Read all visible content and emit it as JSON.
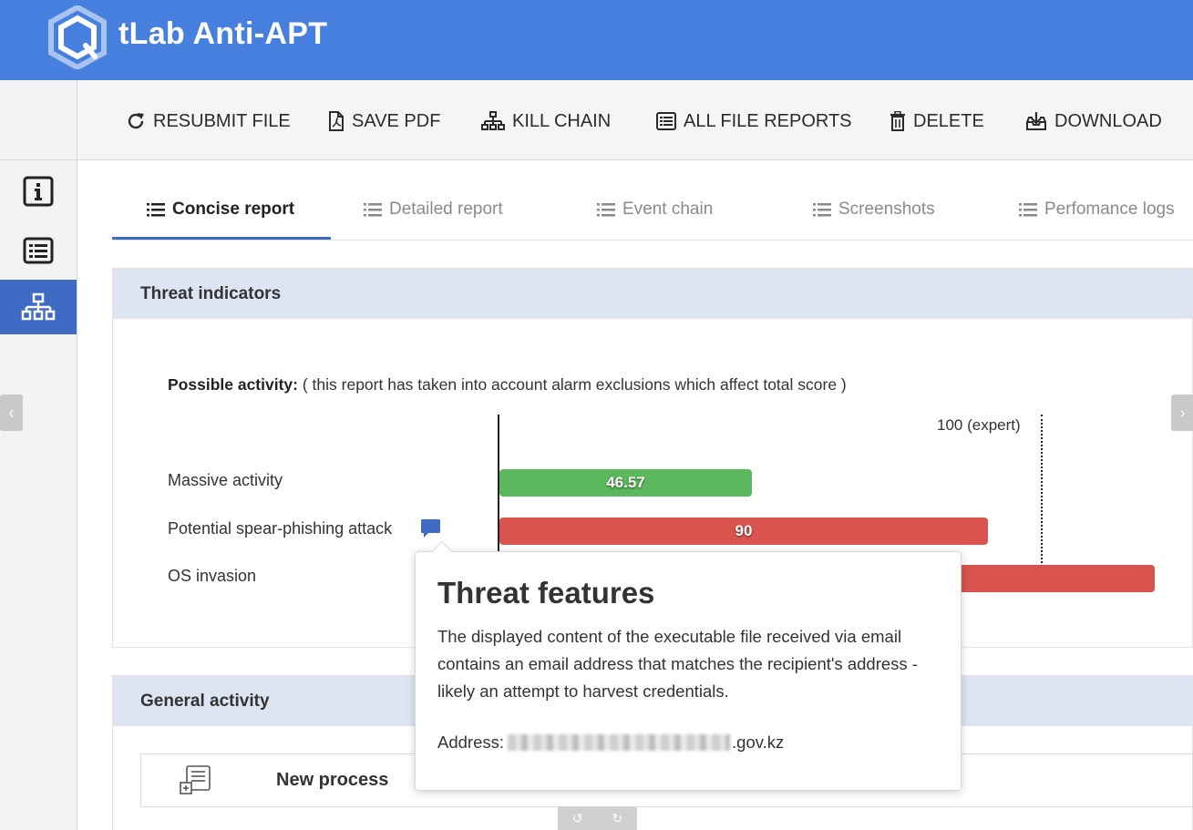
{
  "app": {
    "title": "tLab Anti-APT"
  },
  "toolbar": {
    "resubmit": "RESUBMIT FILE",
    "save_pdf": "SAVE PDF",
    "kill_chain": "KILL CHAIN",
    "all_reports": "ALL FILE REPORTS",
    "delete": "DELETE",
    "download": "DOWNLOAD"
  },
  "sidebar": {
    "items": [
      {
        "name": "info-icon",
        "active": false
      },
      {
        "name": "list-icon",
        "active": false
      },
      {
        "name": "sitemap-icon",
        "active": true
      }
    ]
  },
  "tabs": {
    "concise": "Concise report",
    "detailed": "Detailed report",
    "event_chain": "Event chain",
    "screenshots": "Screenshots",
    "perf_logs": "Perfomance logs",
    "active": "Concise report"
  },
  "threat_indicators": {
    "title": "Threat indicators",
    "possible_label": "Possible activity:",
    "possible_note": " ( this report has taken into account alarm exclusions which affect total score )",
    "expert_label": "100 (expert)",
    "items": [
      {
        "label": "Massive activity",
        "score": 46.57,
        "score_text": "46.57",
        "color": "#5cb85c"
      },
      {
        "label": "Potential spear-phishing attack",
        "score": 90,
        "score_text": "90",
        "color": "#d9534f",
        "has_comment": true
      },
      {
        "label": "OS invasion",
        "score_text": "",
        "color": "#d9534f"
      }
    ]
  },
  "general_activity": {
    "title": "General activity",
    "process_label": "New process"
  },
  "tooltip": {
    "title": "Threat features",
    "description": "The displayed content of the executable file received via email contains an email address that matches the recipient's address - likely an attempt to harvest credentials.",
    "address_label": "Address:",
    "address_suffix": ".gov.kz"
  },
  "colors": {
    "header": "#467fdd",
    "active_nav": "#3f6bc4",
    "section_head": "#dde4f2",
    "green": "#5cb85c",
    "red": "#d9534f"
  }
}
